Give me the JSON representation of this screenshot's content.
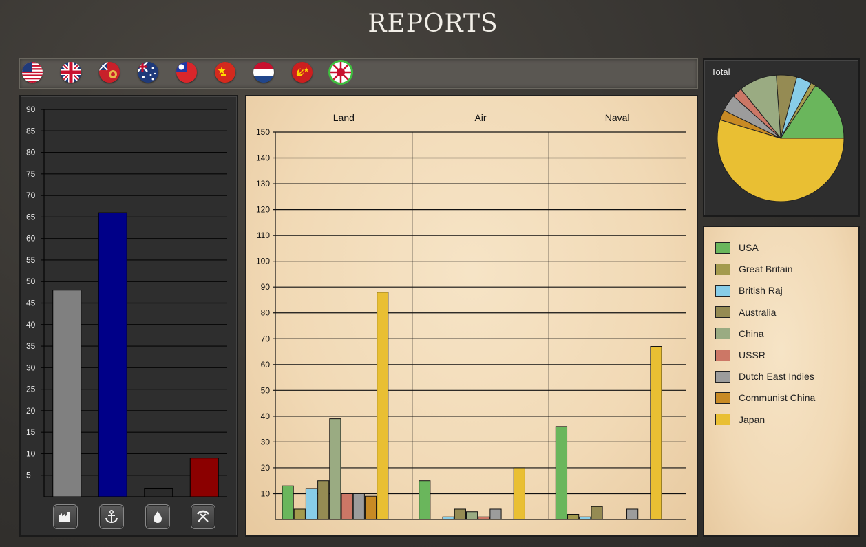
{
  "page": {
    "title": "REPORTS"
  },
  "flags": [
    {
      "name": "usa-flag-icon"
    },
    {
      "name": "great-britain-flag-icon"
    },
    {
      "name": "british-raj-flag-icon"
    },
    {
      "name": "australia-flag-icon"
    },
    {
      "name": "china-flag-icon"
    },
    {
      "name": "communist-china-flag-icon"
    },
    {
      "name": "dutch-east-indies-flag-icon"
    },
    {
      "name": "ussr-flag-icon"
    },
    {
      "name": "japan-flag-icon"
    }
  ],
  "resource_buttons": [
    {
      "icon": "factory-icon"
    },
    {
      "icon": "anchor-icon"
    },
    {
      "icon": "oil-drop-icon"
    },
    {
      "icon": "mining-tools-icon"
    }
  ],
  "chart_data": [
    {
      "type": "bar",
      "ylim": [
        0,
        90
      ],
      "yticks": [
        "5",
        "10",
        "15",
        "20",
        "25",
        "30",
        "35",
        "40",
        "45",
        "50",
        "55",
        "60",
        "65",
        "70",
        "75",
        "80",
        "85",
        "90"
      ],
      "categories": [
        "factories",
        "naval",
        "oil",
        "resources"
      ],
      "values": [
        48,
        66,
        2,
        9
      ],
      "colors": [
        "#808080",
        "#000088",
        "#2a2a2a",
        "#8b0000"
      ],
      "grid": true
    },
    {
      "type": "bar",
      "ylim": [
        0,
        150
      ],
      "yticks": [
        "10",
        "20",
        "30",
        "40",
        "50",
        "60",
        "70",
        "80",
        "90",
        "100",
        "110",
        "120",
        "130",
        "140",
        "150"
      ],
      "groups": [
        "Land",
        "Air",
        "Naval"
      ],
      "series": [
        {
          "name": "USA",
          "color": "#6ab65c",
          "values": [
            13,
            15,
            36
          ]
        },
        {
          "name": "Great Britain",
          "color": "#a39a4d",
          "values": [
            4,
            0,
            2
          ]
        },
        {
          "name": "British Raj",
          "color": "#88cde8",
          "values": [
            12,
            1,
            1
          ]
        },
        {
          "name": "Australia",
          "color": "#958b53",
          "values": [
            15,
            4,
            5
          ]
        },
        {
          "name": "China",
          "color": "#9aab82",
          "values": [
            39,
            3,
            0
          ]
        },
        {
          "name": "USSR",
          "color": "#cc7766",
          "values": [
            10,
            1,
            0
          ]
        },
        {
          "name": "Dutch East Indies",
          "color": "#9c9c9c",
          "values": [
            10,
            4,
            4
          ]
        },
        {
          "name": "Communist China",
          "color": "#c88a24",
          "values": [
            9,
            0,
            0
          ]
        },
        {
          "name": "Japan",
          "color": "#e9bf33",
          "values": [
            88,
            20,
            67
          ]
        }
      ],
      "grid": true
    },
    {
      "type": "pie",
      "title": "Total",
      "slices": [
        {
          "name": "USA",
          "color": "#6ab65c",
          "value": 15.7
        },
        {
          "name": "Great Britain",
          "color": "#a39a4d",
          "value": 1.3
        },
        {
          "name": "British Raj",
          "color": "#88cde8",
          "value": 3.9
        },
        {
          "name": "Australia",
          "color": "#958b53",
          "value": 5.2
        },
        {
          "name": "China",
          "color": "#9aab82",
          "value": 9.7
        },
        {
          "name": "USSR",
          "color": "#cc7766",
          "value": 2.6
        },
        {
          "name": "Dutch East Indies",
          "color": "#9c9c9c",
          "value": 4.3
        },
        {
          "name": "Communist China",
          "color": "#c88a24",
          "value": 2.6
        },
        {
          "name": "Japan",
          "color": "#e9bf33",
          "value": 54.7
        }
      ]
    }
  ],
  "legend": {
    "items": [
      {
        "label": "USA",
        "color": "#6ab65c"
      },
      {
        "label": "Great Britain",
        "color": "#a39a4d"
      },
      {
        "label": "British Raj",
        "color": "#88cde8"
      },
      {
        "label": "Australia",
        "color": "#958b53"
      },
      {
        "label": "China",
        "color": "#9aab82"
      },
      {
        "label": "USSR",
        "color": "#cc7766"
      },
      {
        "label": "Dutch East Indies",
        "color": "#9c9c9c"
      },
      {
        "label": "Communist China",
        "color": "#c88a24"
      },
      {
        "label": "Japan",
        "color": "#e9bf33"
      }
    ]
  }
}
